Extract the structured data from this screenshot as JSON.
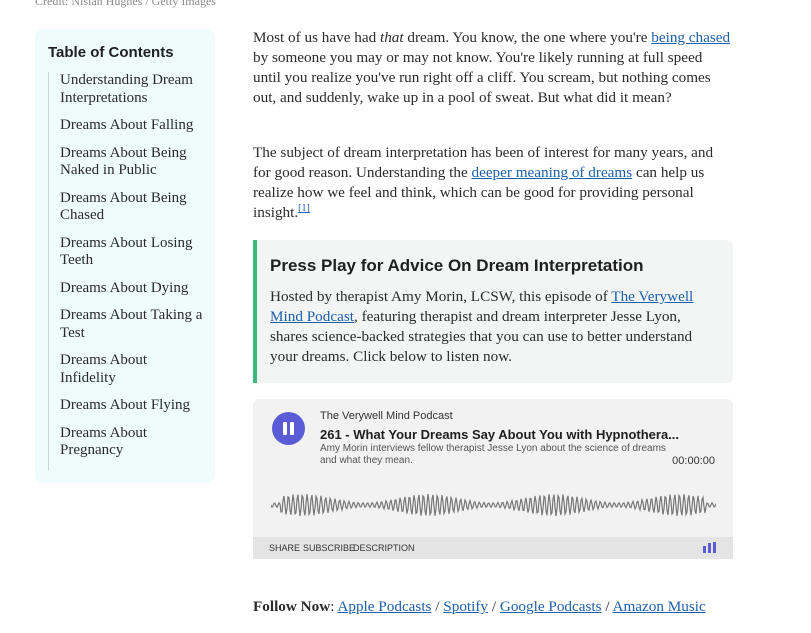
{
  "credit": "Credit: Nisian Hughes / Getty Images",
  "toc": {
    "title": "Table of Contents",
    "items": [
      "Understanding Dream Interpretations",
      "Dreams About Falling",
      "Dreams About Being Naked in Public",
      "Dreams About Being Chased",
      "Dreams About Losing Teeth",
      "Dreams About Dying",
      "Dreams About Taking a Test",
      "Dreams About Infidelity",
      "Dreams About Flying",
      "Dreams About Pregnancy"
    ]
  },
  "article": {
    "p1_start": "Most of us have had ",
    "p1_em": "that",
    "p1_mid": " dream. You know, the one where you're ",
    "p1_link": "being chased",
    "p1_end": " by someone you may or may not know. You're likely running at full speed until you realize you've run right off a cliff. You scream, but nothing comes out, and suddenly, wake up in a pool of sweat. But what did it mean?",
    "p2_start": "The subject of dream interpretation has been of interest for many years, and for good reason. Understanding the ",
    "p2_link": "deeper meaning of dreams",
    "p2_end": " can help us realize how we feel and think, which can be good for providing personal insight.",
    "p2_ref": "[1]"
  },
  "callout": {
    "title": "Press Play for Advice On Dream Interpretation",
    "text_start": "Hosted by therapist Amy Morin, LCSW, this episode of ",
    "link": "The Verywell Mind Podcast",
    "text_end": ", featuring therapist and dream interpreter Jesse Lyon, shares science-backed strategies that you can use to better understand your dreams. Click below to listen now.",
    "accent_color": "#3cb97f"
  },
  "player": {
    "show": "The Verywell Mind Podcast",
    "episode": "261 - What Your Dreams Say About You with Hypnothera...",
    "description": "Amy Morin interviews fellow therapist Jesse Lyon about the science of dreams and what they mean.",
    "time": "00:00:00",
    "share": "SHARE",
    "subscribe": "SUBSCRIBE",
    "desc_btn": "DESCRIPTION",
    "accent_color": "#5b5bd6"
  },
  "follow": {
    "label": "Follow Now",
    "colon": ": ",
    "sep": " / ",
    "links": [
      "Apple Podcasts",
      "Spotify",
      "Google Podcasts",
      "Amazon Music"
    ]
  }
}
